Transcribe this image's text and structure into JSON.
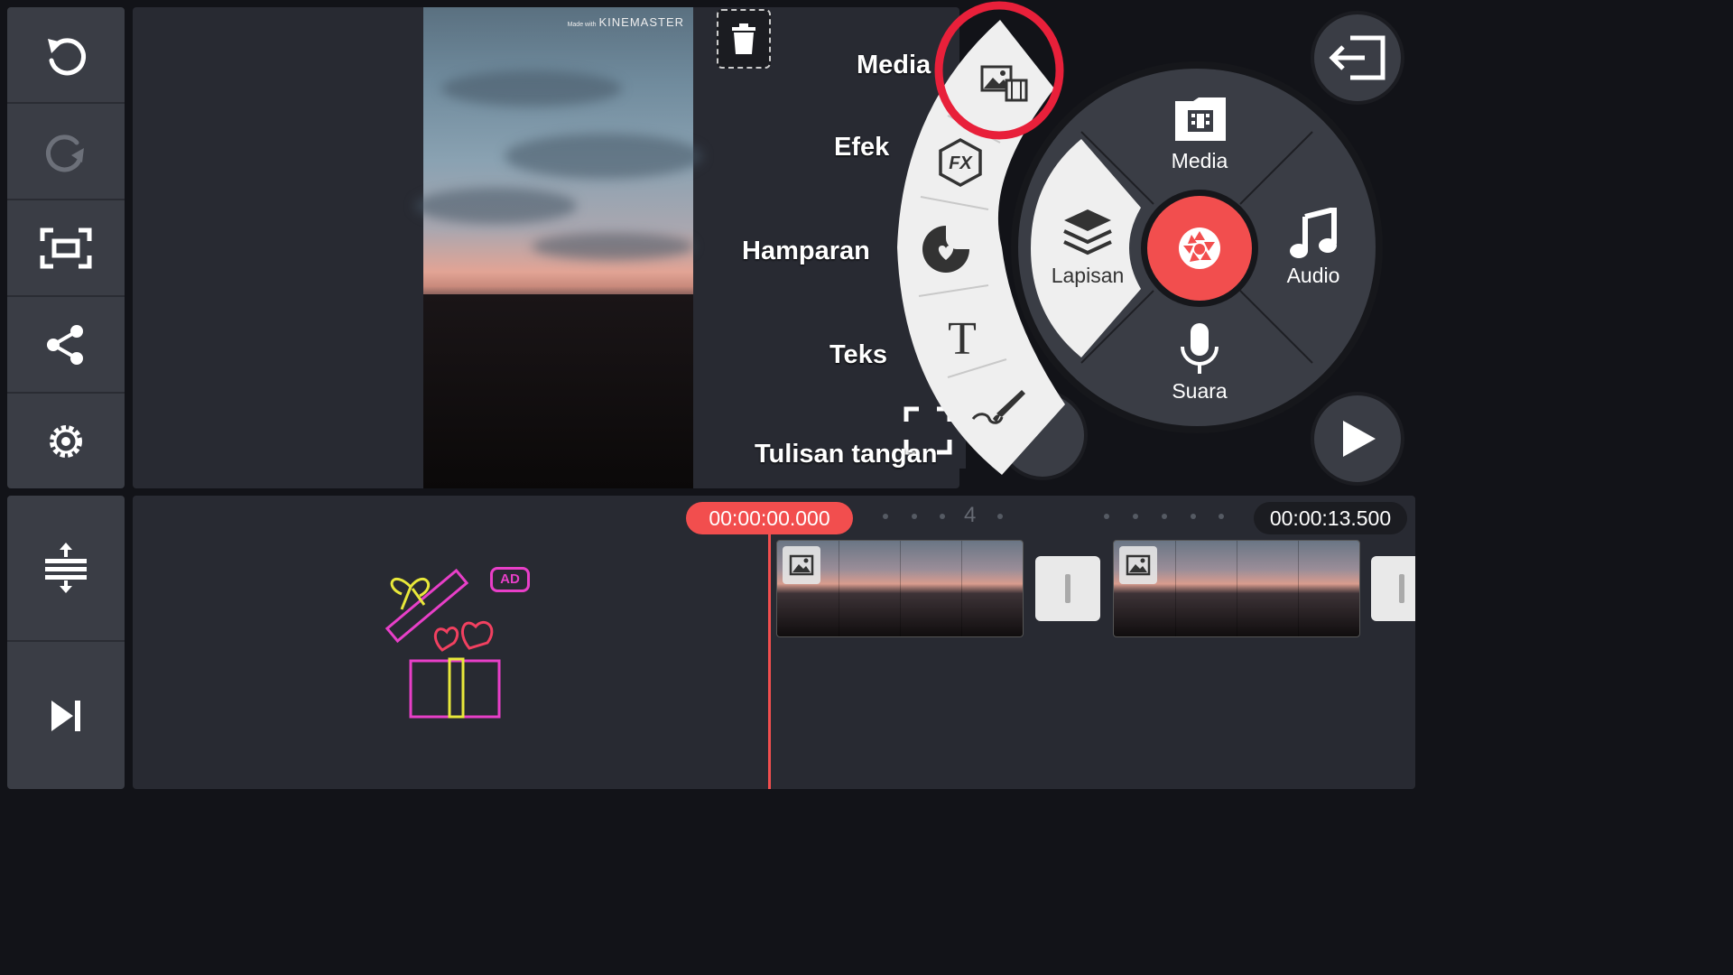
{
  "toolbar": {
    "undo_icon": "undo-icon",
    "redo_icon": "redo-icon",
    "fullscreen_icon": "fullscreen-icon",
    "share_icon": "share-icon",
    "settings_icon": "settings-icon",
    "expand_timeline_icon": "expand-timeline-icon",
    "skip_end_icon": "skip-to-end-icon"
  },
  "preview": {
    "watermark_small": "Made with",
    "watermark_brand": "KINEMASTER"
  },
  "media_menu": {
    "media": "Media",
    "effect": "Efek",
    "overlay": "Hamparan",
    "text": "Teks",
    "handwriting": "Tulisan tangan"
  },
  "main_wheel": {
    "media": "Media",
    "layer": "Lapisan",
    "audio": "Audio",
    "voice": "Suara"
  },
  "timeline": {
    "current_time": "00:00:00.000",
    "total_time": "00:00:13.500",
    "marker": "4",
    "ad_badge": "AD"
  },
  "colors": {
    "accent_red": "#f24e4e",
    "highlight_circle": "#e8203a",
    "panel_dark": "#282a32",
    "toolbar_gray": "#3a3d45"
  }
}
